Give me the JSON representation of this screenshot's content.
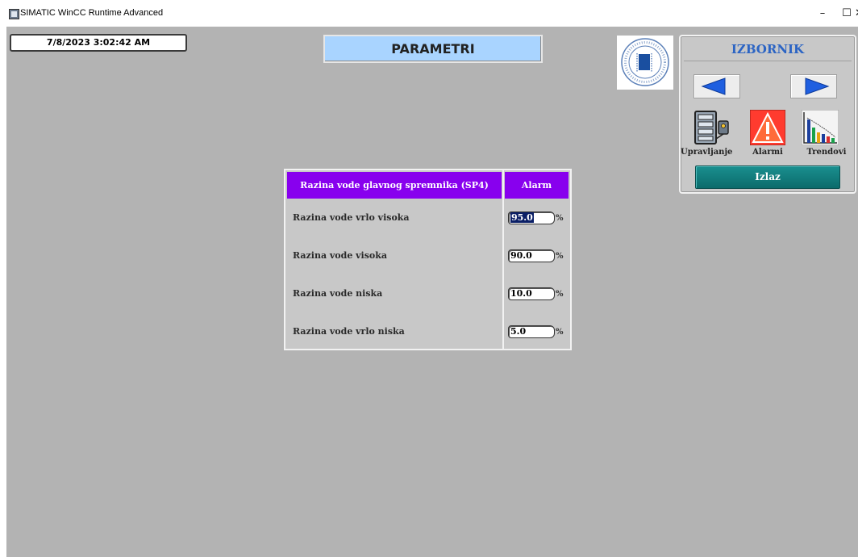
{
  "window": {
    "title": "SIMATIC WinCC Runtime Advanced",
    "minimize": "–",
    "maximize": "☐",
    "close": "✕"
  },
  "header": {
    "datetime": "7/8/2023 3:02:42 AM",
    "page_title": "PARAMETRI"
  },
  "menu": {
    "title": "IZBORNIK",
    "nav_left_icon": "arrow-left-icon",
    "nav_right_icon": "arrow-right-icon",
    "items": [
      {
        "label": "Upravljanje",
        "icon": "control-panel-icon"
      },
      {
        "label": "Alarmi",
        "icon": "warning-icon"
      },
      {
        "label": "Trendovi",
        "icon": "trend-chart-icon"
      }
    ],
    "exit_label": "Izlaz"
  },
  "table": {
    "header_name": "Razina vode glavnog spremnika (SP4)",
    "header_alarm": "Alarm",
    "rows": [
      {
        "label": "Razina vode vrlo visoka",
        "value": "95.0",
        "unit": "%"
      },
      {
        "label": "Razina vode visoka",
        "value": "90.0",
        "unit": "%"
      },
      {
        "label": "Razina vode niska",
        "value": "10.0",
        "unit": "%"
      },
      {
        "label": "Razina vode vrlo niska",
        "value": "5.0",
        "unit": "%"
      }
    ]
  },
  "colors": {
    "canvas": "#b3b3b3",
    "title_box": "#a9d4ff",
    "table_header": "#8800ee",
    "menu_title": "#2b64c4",
    "exit_button": "#0b6b6b",
    "nav_arrow": "#1f5fe0"
  }
}
